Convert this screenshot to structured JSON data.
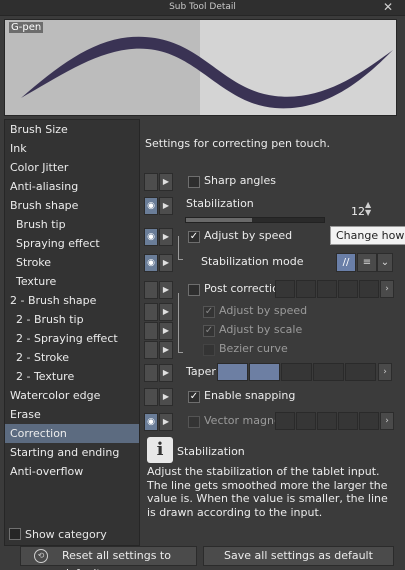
{
  "window": {
    "title": "Sub Tool Detail",
    "close_glyph": "✕"
  },
  "preview": {
    "tool_name": "G-pen",
    "stroke_color": "#3a3354"
  },
  "categories": [
    "Brush Size",
    "Ink",
    "Color Jitter",
    "Anti-aliasing",
    "Brush shape",
    "Brush tip",
    "Spraying effect",
    "Stroke",
    "Texture",
    "2 - Brush shape",
    "2 - Brush tip",
    "2 - Spraying effect",
    "2 - Stroke",
    "2 - Texture",
    "Watercolor edge",
    "Erase",
    "Correction",
    "Starting and ending",
    "Anti-overflow"
  ],
  "selected_category": "Correction",
  "show_category": {
    "label": "Show category",
    "checked": false
  },
  "panel": {
    "heading": "Settings for correcting pen touch.",
    "sharp_angles": {
      "label": "Sharp angles",
      "checked": false
    },
    "stabilization": {
      "label": "Stabilization",
      "value": "12",
      "level_fraction": 0.48
    },
    "adjust_by_speed": {
      "label": "Adjust by speed",
      "checked": true
    },
    "stabilization_mode": {
      "label": "Stabilization mode"
    },
    "tooltip": "Change how",
    "post_correction": {
      "label": "Post correction",
      "checked": false
    },
    "sub_adjust_speed": {
      "label": "Adjust by speed",
      "checked": true
    },
    "sub_adjust_scale": {
      "label": "Adjust by scale",
      "checked": true
    },
    "bezier_curve": {
      "label": "Bezier curve",
      "checked": false
    },
    "taper": {
      "label": "Taper"
    },
    "enable_snapping": {
      "label": "Enable snapping",
      "checked": true
    },
    "vector_magnet": {
      "label": "Vector magnet",
      "checked": false
    }
  },
  "info": {
    "title": "Stabilization",
    "text": "Adjust the stabilization of the tablet input. The line gets smoothed more the larger the value is. When the value is smaller, the line is drawn according to the input."
  },
  "buttons": {
    "reset": "Reset all settings to default",
    "save": "Save all settings as default"
  },
  "icons": {
    "eye": "eye-icon",
    "check": "✓",
    "arrow": "▶",
    "more": "›",
    "info": "i"
  },
  "colors": {
    "accent_selected": "#5c6b80",
    "toggle_on": "#6a7fa8"
  }
}
